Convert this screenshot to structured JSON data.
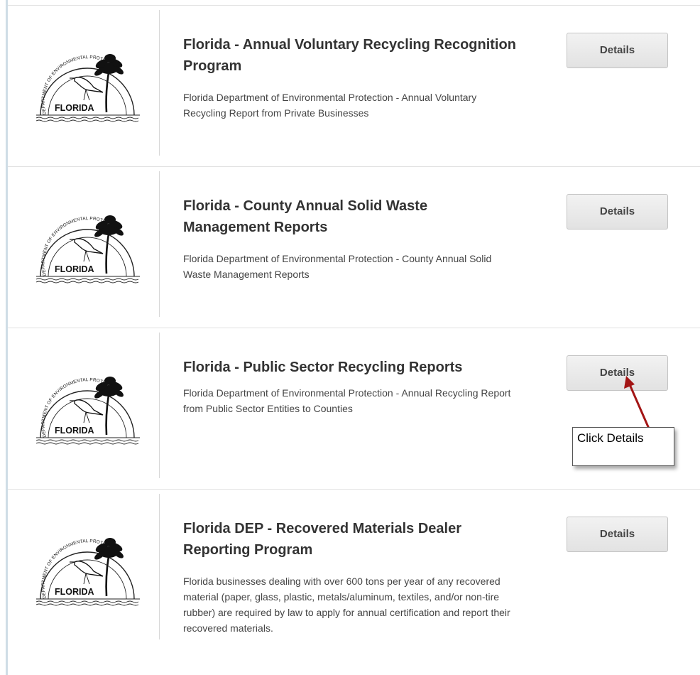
{
  "colors": {
    "accent_arrow": "#a31515",
    "button_bg": "#e8e8e8",
    "title_text": "#333333"
  },
  "cards": [
    {
      "logo_icon": "florida-dep-seal-icon",
      "title": "Florida - Annual Voluntary Recycling Recognition Program",
      "description": "Florida Department of Environmental Protection - Annual Voluntary Recycling Report from Private Businesses",
      "button_label": "Details"
    },
    {
      "logo_icon": "florida-dep-seal-icon",
      "title": "Florida - County Annual Solid Waste Management Reports",
      "description": "Florida Department of Environmental Protection - County Annual Solid Waste Management Reports",
      "button_label": "Details"
    },
    {
      "logo_icon": "florida-dep-seal-icon",
      "title": "Florida - Public Sector Recycling Reports",
      "description": "Florida Department of Environmental Protection - Annual Recycling Report from Public Sector Entities to Counties",
      "button_label": "Details"
    },
    {
      "logo_icon": "florida-dep-seal-icon",
      "title": "Florida DEP - Recovered Materials Dealer Reporting Program",
      "description": "Florida businesses dealing with over 600 tons per year of any recovered material (paper, glass, plastic, metals/aluminum, textiles, and/or non-tire rubber) are required by law to apply for annual certification and report their recovered materials.",
      "button_label": "Details"
    }
  ],
  "seal": {
    "arc_text": "DEPARTMENT OF ENVIRONMENTAL PROTECTION",
    "state_text": "FLORIDA"
  },
  "annotation": {
    "callout_text": "Click Details"
  }
}
